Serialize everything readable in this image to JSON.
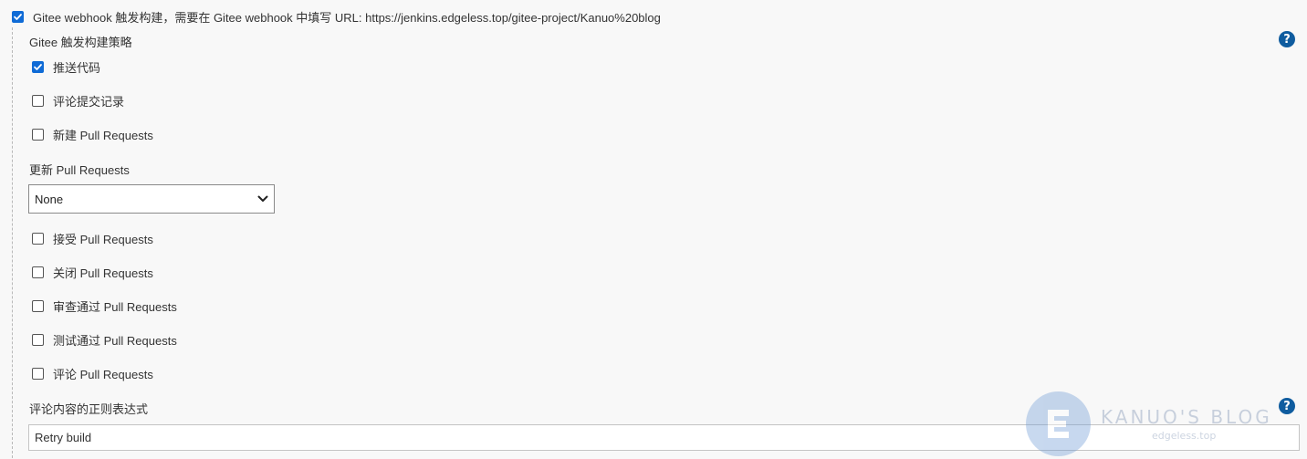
{
  "trigger": {
    "label": "Gitee webhook 触发构建，需要在 Gitee webhook 中填写 URL: https://jenkins.edgeless.top/gitee-project/Kanuo%20blog",
    "checked": true
  },
  "strategy": {
    "heading": "Gitee 触发构建策略",
    "help_icon": "question-mark-icon"
  },
  "options_top": [
    {
      "label": "推送代码",
      "checked": true
    },
    {
      "label": "评论提交记录",
      "checked": false
    },
    {
      "label": "新建 Pull Requests",
      "checked": false
    }
  ],
  "update_pr": {
    "label": "更新 Pull Requests",
    "selected": "None"
  },
  "options_bottom": [
    {
      "label": "接受 Pull Requests",
      "checked": false
    },
    {
      "label": "关闭 Pull Requests",
      "checked": false
    },
    {
      "label": "审查通过 Pull Requests",
      "checked": false
    },
    {
      "label": "测试通过 Pull Requests",
      "checked": false
    },
    {
      "label": "评论 Pull Requests",
      "checked": false
    }
  ],
  "comment_regex": {
    "label": "评论内容的正则表达式",
    "value": "Retry build",
    "help_icon": "question-mark-icon"
  },
  "watermark": {
    "title": "KANUO'S BLOG",
    "subtitle": "edgeless.top"
  },
  "colors": {
    "checkbox_checked": "#0f6bd6",
    "help_icon": "#0f5c9f",
    "background": "#f8f8f8"
  }
}
